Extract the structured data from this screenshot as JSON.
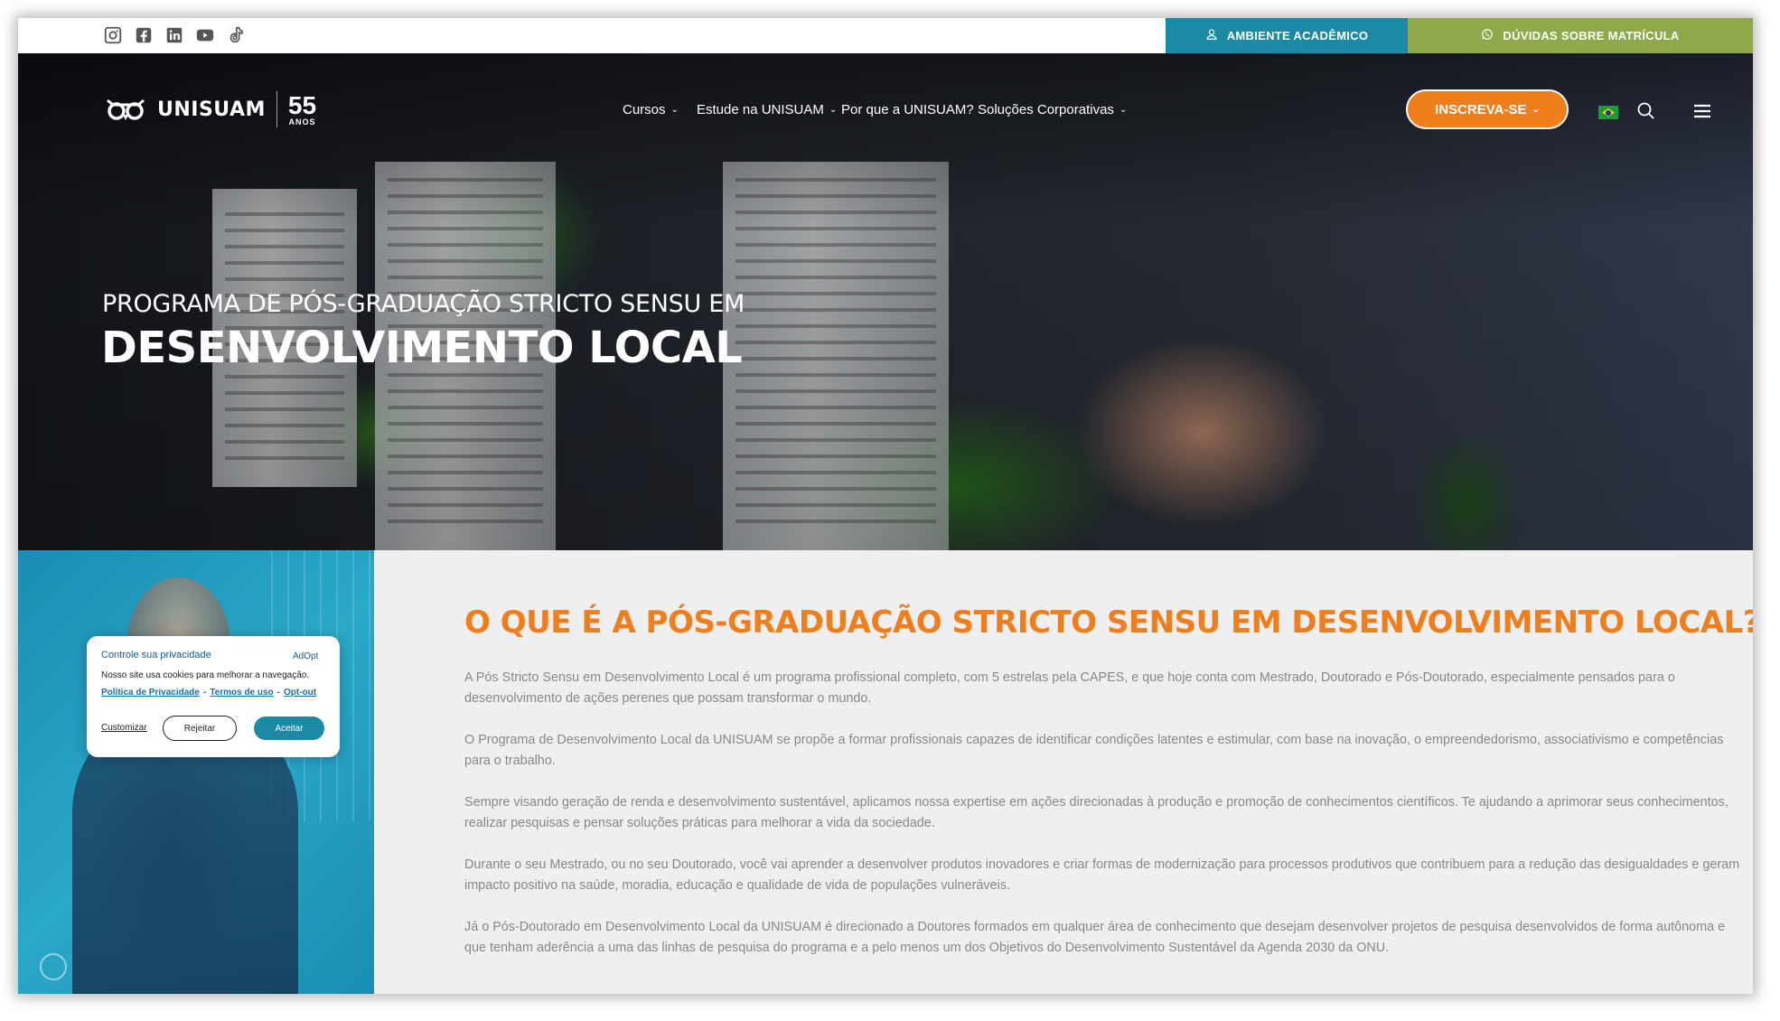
{
  "topbar": {
    "social_icons": [
      "instagram-icon",
      "facebook-icon",
      "linkedin-icon",
      "youtube-icon",
      "tiktok-icon"
    ],
    "ambiente_label": "AMBIENTE ACADÊMICO",
    "duvidas_label": "DÚVIDAS SOBRE MATRÍCULA"
  },
  "header": {
    "logo_text": "UNISUAM",
    "logo_years": "55",
    "logo_years_label": "ANOS",
    "nav": [
      {
        "label": "Cursos"
      },
      {
        "label": "Estude na UNISUAM"
      },
      {
        "label": "Por que a UNISUAM?"
      },
      {
        "label": "Soluções Corporativas"
      }
    ],
    "cta_label": "INSCREVA-SE",
    "chevron": "⌄"
  },
  "hero": {
    "subtitle": "PROGRAMA DE PÓS-GRADUAÇÃO STRICTO SENSU EM",
    "title": "DESENVOLVIMENTO LOCAL"
  },
  "content": {
    "heading": "O QUE É A PÓS-GRADUAÇÃO STRICTO SENSU EM DESENVOLVIMENTO LOCAL?",
    "paragraphs": [
      "A Pós Stricto Sensu em Desenvolvimento Local é um programa profissional completo, com 5 estrelas pela CAPES, e que hoje conta com Mestrado, Doutorado e Pós-Doutorado, especialmente pensados para o desenvolvimento de ações perenes que possam transformar o mundo.",
      "O Programa de Desenvolvimento Local da UNISUAM se propõe a formar profissionais capazes de identificar condições latentes e estimular, com base na inovação, o empreendedorismo, associativismo e competências para o trabalho.",
      "Sempre visando geração de renda e desenvolvimento sustentável, aplicamos nossa expertise em ações direcionadas à produção e promoção de conhecimentos científicos. Te ajudando a aprimorar seus conhecimentos, realizar pesquisas e pensar soluções práticas para melhorar a vida da sociedade.",
      "Durante o seu Mestrado, ou no seu Doutorado, você vai aprender a desenvolver produtos inovadores e criar formas de modernização para processos produtivos que contribuem para a redução das desigualdades e geram impacto positivo na saúde, moradia, educação e qualidade de vida de populações vulneráveis.",
      "Já o Pós-Doutorado em Desenvolvimento Local da UNISUAM é direcionado a Doutores formados em qualquer área de conhecimento que desejam desenvolver projetos de pesquisa desenvolvidos de forma autônoma e que tenham aderência a uma das linhas de pesquisa do programa e a pelo menos um dos Objetivos do Desenvolvimento Sustentável da Agenda 2030 da ONU."
    ]
  },
  "cookie": {
    "title": "Controle sua privacidade",
    "brand": "AdOpt",
    "message": "Nosso site usa cookies para melhorar a navegação.",
    "links": [
      "Política de Privacidade",
      "Termos de uso",
      "Opt-out"
    ],
    "separator": "-",
    "customize_label": "Customizar",
    "reject_label": "Rejeitar",
    "accept_label": "Aceitar"
  },
  "colors": {
    "accent_orange": "#f07e1d",
    "teal": "#1a8aa5",
    "olive_green": "#8fa94a",
    "body_text": "#888888"
  }
}
